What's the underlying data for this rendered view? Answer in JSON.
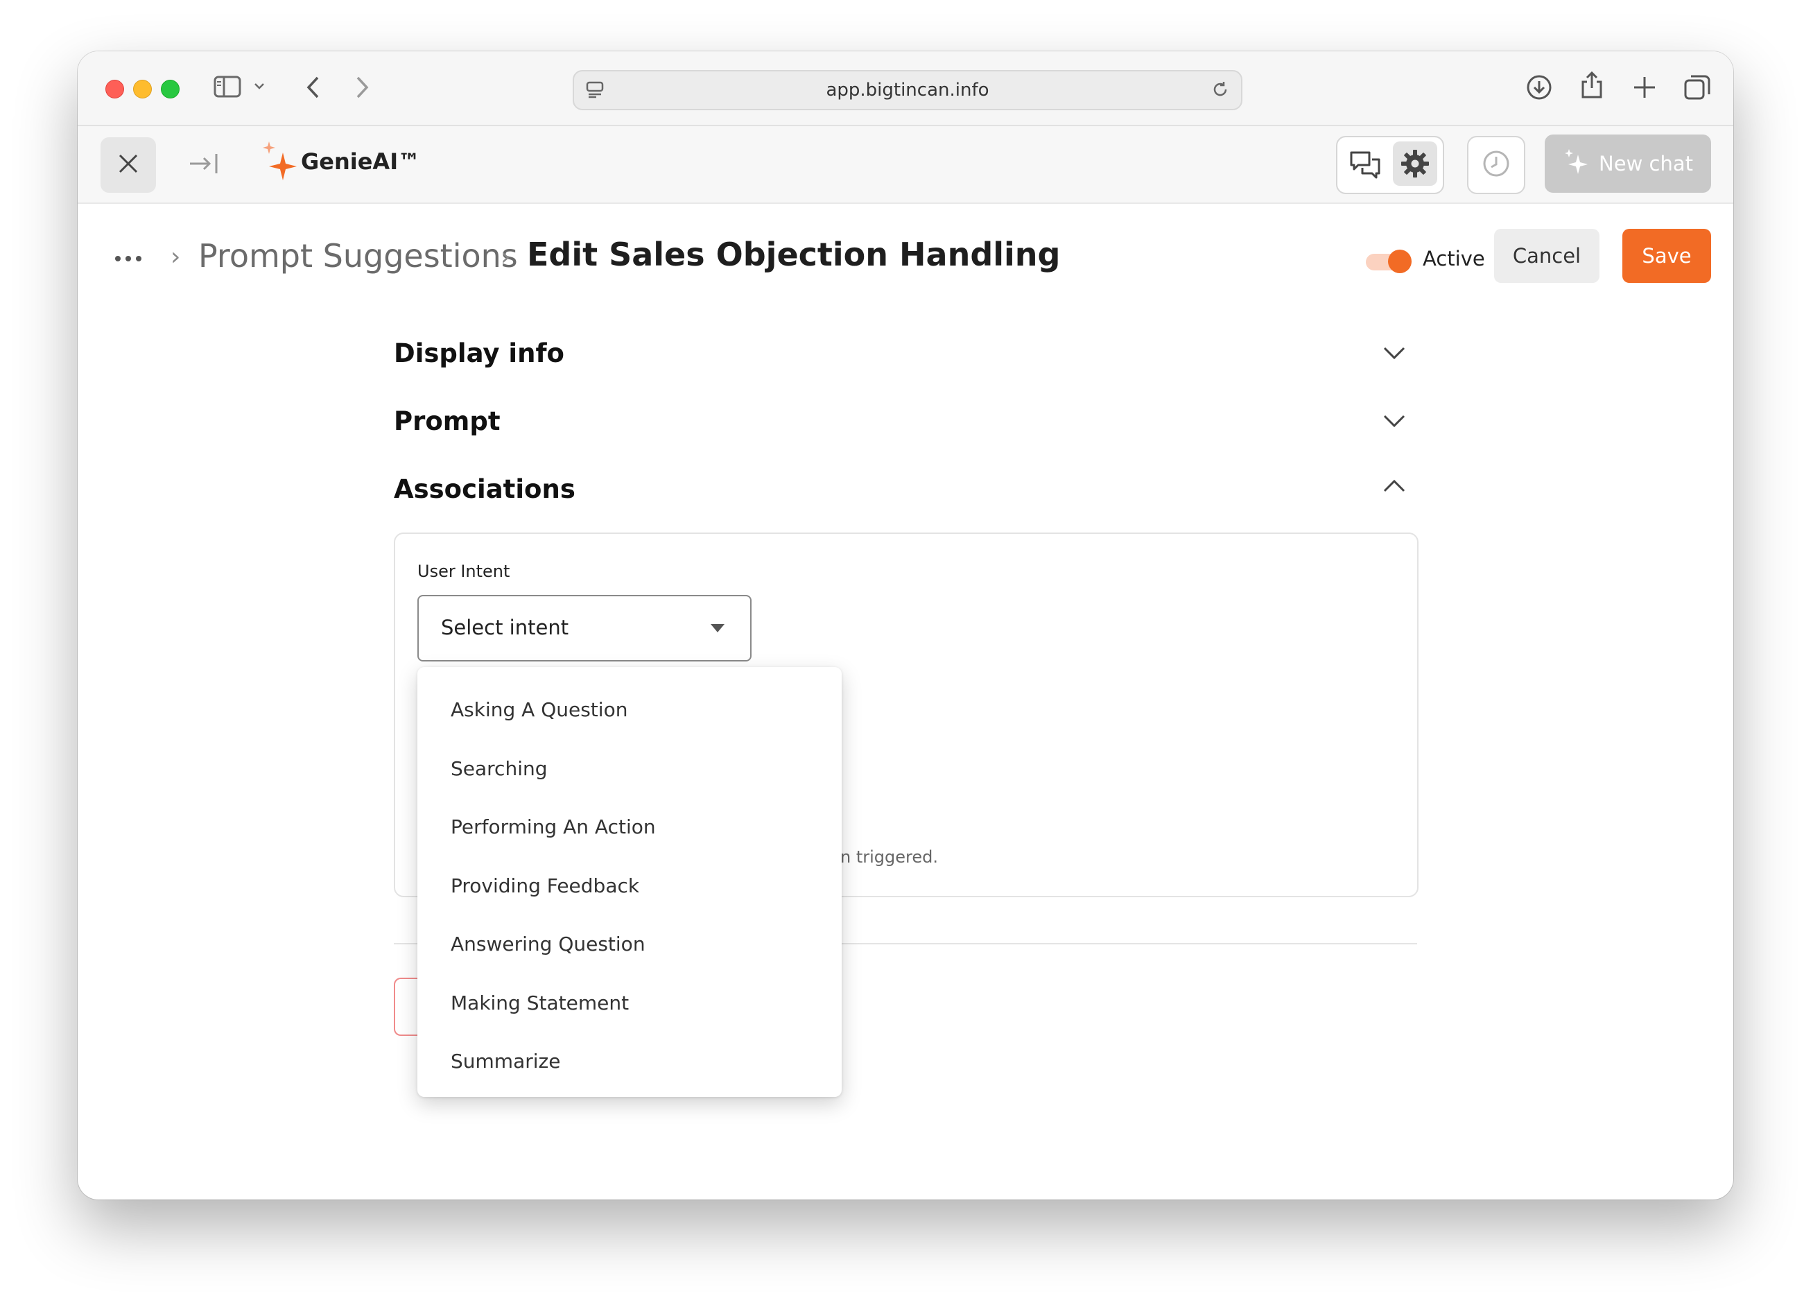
{
  "browser": {
    "url": "app.bigtincan.info"
  },
  "app": {
    "brand": "GenieAI™",
    "new_chat_label": "New chat"
  },
  "header": {
    "breadcrumb_parent": "Prompt Suggestions",
    "page_title": "Edit Sales Objection Handling",
    "active_label": "Active",
    "active": true,
    "cancel_label": "Cancel",
    "save_label": "Save"
  },
  "sections": {
    "display_info": "Display info",
    "prompt": "Prompt",
    "associations": "Associations"
  },
  "associations": {
    "user_intent_label": "User Intent",
    "select_value": "Select intent",
    "hint_visible": "n triggered."
  },
  "intent_menu": {
    "items": [
      "Asking A Question",
      "Searching",
      "Performing An Action",
      "Providing Feedback",
      "Answering Question",
      "Making Statement",
      "Summarize"
    ]
  },
  "colors": {
    "accent": "#f26b25",
    "accent_light": "#fbd2c0",
    "disabled_button": "#c9c9c9"
  }
}
